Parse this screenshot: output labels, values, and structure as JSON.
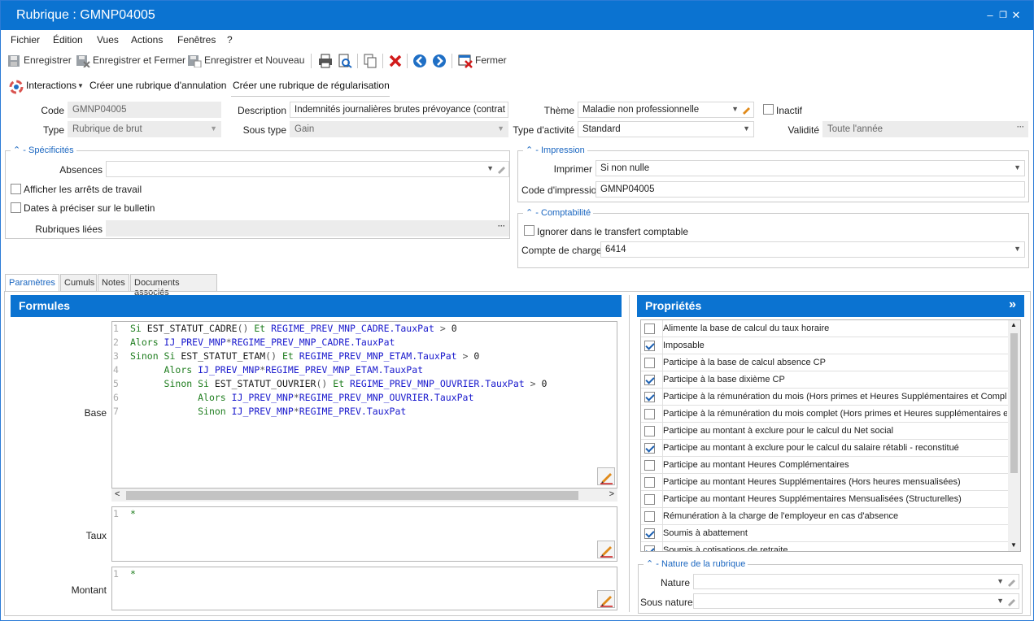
{
  "window": {
    "title": "Rubrique : GMNP04005",
    "min": "‒",
    "max": "❐",
    "close": "✕"
  },
  "menu": [
    "Fichier",
    "Édition",
    "Vues",
    "Actions",
    "Fenêtres",
    "?"
  ],
  "toolbar": {
    "save": "Enregistrer",
    "save_close": "Enregistrer et Fermer",
    "save_new": "Enregistrer et Nouveau",
    "close": "Fermer"
  },
  "toolbar2": {
    "interactions": "Interactions",
    "cancel_rubric": "Créer une rubrique d'annulation",
    "regul_rubric": "Créer une rubrique de régularisation"
  },
  "form": {
    "code_label": "Code",
    "code_value": "GMNP04005",
    "description_label": "Description",
    "description_value": "Indemnités journalières brutes prévoyance (contrat ob",
    "theme_label": "Thème",
    "theme_value": "Maladie non professionnelle",
    "inactive_label": "Inactif",
    "type_label": "Type",
    "type_value": "Rubrique de brut",
    "subtype_label": "Sous type",
    "subtype_value": "Gain",
    "activity_label": "Type d'activité",
    "activity_value": "Standard",
    "validity_label": "Validité",
    "validity_value": "Toute l'année"
  },
  "specificites": {
    "title": "Spécificités",
    "absences_label": "Absences",
    "absences_value": "",
    "show_stops": "Afficher les arrêts de travail",
    "dates": "Dates à préciser sur le bulletin",
    "linked_label": "Rubriques liées",
    "linked_value": ""
  },
  "impression": {
    "title": "Impression",
    "print_label": "Imprimer",
    "print_value": "Si non nulle",
    "code_label": "Code d'impression",
    "code_value": "GMNP04005"
  },
  "comptabilite": {
    "title": "Comptabilité",
    "ignore": "Ignorer dans le transfert comptable",
    "account_label": "Compte de charges",
    "account_value": "6414"
  },
  "tabs": [
    "Paramètres",
    "Cumuls",
    "Notes",
    "Documents associés"
  ],
  "formules": {
    "title": "Formules",
    "base_label": "Base",
    "taux_label": "Taux",
    "montant_label": "Montant",
    "base_lines": [
      {
        "n": "1",
        "indent": "",
        "parts": [
          [
            "kw",
            "Si "
          ],
          [
            "fn",
            "EST_STATUT_CADRE"
          ],
          [
            "op",
            "() "
          ],
          [
            "kw",
            "Et "
          ],
          [
            "vr",
            "REGIME_PREV_MNP_CADRE.TauxPat"
          ],
          [
            "op",
            " > "
          ],
          [
            "fn",
            "0"
          ]
        ]
      },
      {
        "n": "2",
        "indent": "",
        "parts": [
          [
            "kw",
            "Alors "
          ],
          [
            "vr",
            "IJ_PREV_MNP"
          ],
          [
            "op",
            "*"
          ],
          [
            "vr",
            "REGIME_PREV_MNP_CADRE.TauxPat"
          ]
        ]
      },
      {
        "n": "3",
        "indent": "",
        "parts": [
          [
            "kw",
            "Sinon Si "
          ],
          [
            "fn",
            "EST_STATUT_ETAM"
          ],
          [
            "op",
            "() "
          ],
          [
            "kw",
            "Et "
          ],
          [
            "vr",
            "REGIME_PREV_MNP_ETAM.TauxPat"
          ],
          [
            "op",
            " > "
          ],
          [
            "fn",
            "0"
          ]
        ]
      },
      {
        "n": "4",
        "indent": "      ",
        "parts": [
          [
            "kw",
            "Alors "
          ],
          [
            "vr",
            "IJ_PREV_MNP"
          ],
          [
            "op",
            "*"
          ],
          [
            "vr",
            "REGIME_PREV_MNP_ETAM.TauxPat"
          ]
        ]
      },
      {
        "n": "5",
        "indent": "      ",
        "parts": [
          [
            "kw",
            "Sinon Si "
          ],
          [
            "fn",
            "EST_STATUT_OUVRIER"
          ],
          [
            "op",
            "() "
          ],
          [
            "kw",
            "Et "
          ],
          [
            "vr",
            "REGIME_PREV_MNP_OUVRIER.TauxPat"
          ],
          [
            "op",
            " > "
          ],
          [
            "fn",
            "0"
          ]
        ]
      },
      {
        "n": "6",
        "indent": "            ",
        "parts": [
          [
            "kw",
            "Alors "
          ],
          [
            "vr",
            "IJ_PREV_MNP"
          ],
          [
            "op",
            "*"
          ],
          [
            "vr",
            "REGIME_PREV_MNP_OUVRIER.TauxPat"
          ]
        ]
      },
      {
        "n": "7",
        "indent": "            ",
        "parts": [
          [
            "kw",
            "Sinon "
          ],
          [
            "vr",
            "IJ_PREV_MNP"
          ],
          [
            "op",
            "*"
          ],
          [
            "vr",
            "REGIME_PREV.TauxPat"
          ]
        ]
      }
    ],
    "taux_line": {
      "n": "1",
      "text": "*"
    },
    "montant_line": {
      "n": "1",
      "text": "*"
    }
  },
  "proprietes": {
    "title": "Propriétés",
    "expand": "»",
    "items": [
      {
        "label": "Alimente la base de calcul du taux horaire",
        "checked": false
      },
      {
        "label": "Imposable",
        "checked": true
      },
      {
        "label": "Participe à la base de calcul absence CP",
        "checked": false
      },
      {
        "label": "Participe à la base dixième CP",
        "checked": true
      },
      {
        "label": "Participe à la rémunération du mois (Hors primes et Heures Supplémentaires et Compl...",
        "checked": true
      },
      {
        "label": "Participe à la rémunération du mois complet (Hors primes et Heures supplémentaires e...",
        "checked": false
      },
      {
        "label": "Participe au montant à exclure pour le calcul du Net social",
        "checked": false
      },
      {
        "label": "Participe au montant à exclure pour le calcul du salaire rétabli - reconstitué",
        "checked": true
      },
      {
        "label": "Participe au montant Heures Complémentaires",
        "checked": false
      },
      {
        "label": "Participe au montant Heures Supplémentaires (Hors heures mensualisées)",
        "checked": false
      },
      {
        "label": "Participe au montant Heures Supplémentaires Mensualisées (Structurelles)",
        "checked": false
      },
      {
        "label": "Rémunération à la charge de l'employeur en cas d'absence",
        "checked": false
      },
      {
        "label": "Soumis à abattement",
        "checked": true
      },
      {
        "label": "Soumis à cotisations de retraite",
        "checked": true
      }
    ]
  },
  "nature": {
    "title": "Nature de la rubrique",
    "nature_label": "Nature",
    "nature_value": "",
    "subnature_label": "Sous nature",
    "subnature_value": ""
  },
  "colors": {
    "accent": "#0b73d1",
    "link": "#1a66c0",
    "delete": "#d11a1a"
  }
}
